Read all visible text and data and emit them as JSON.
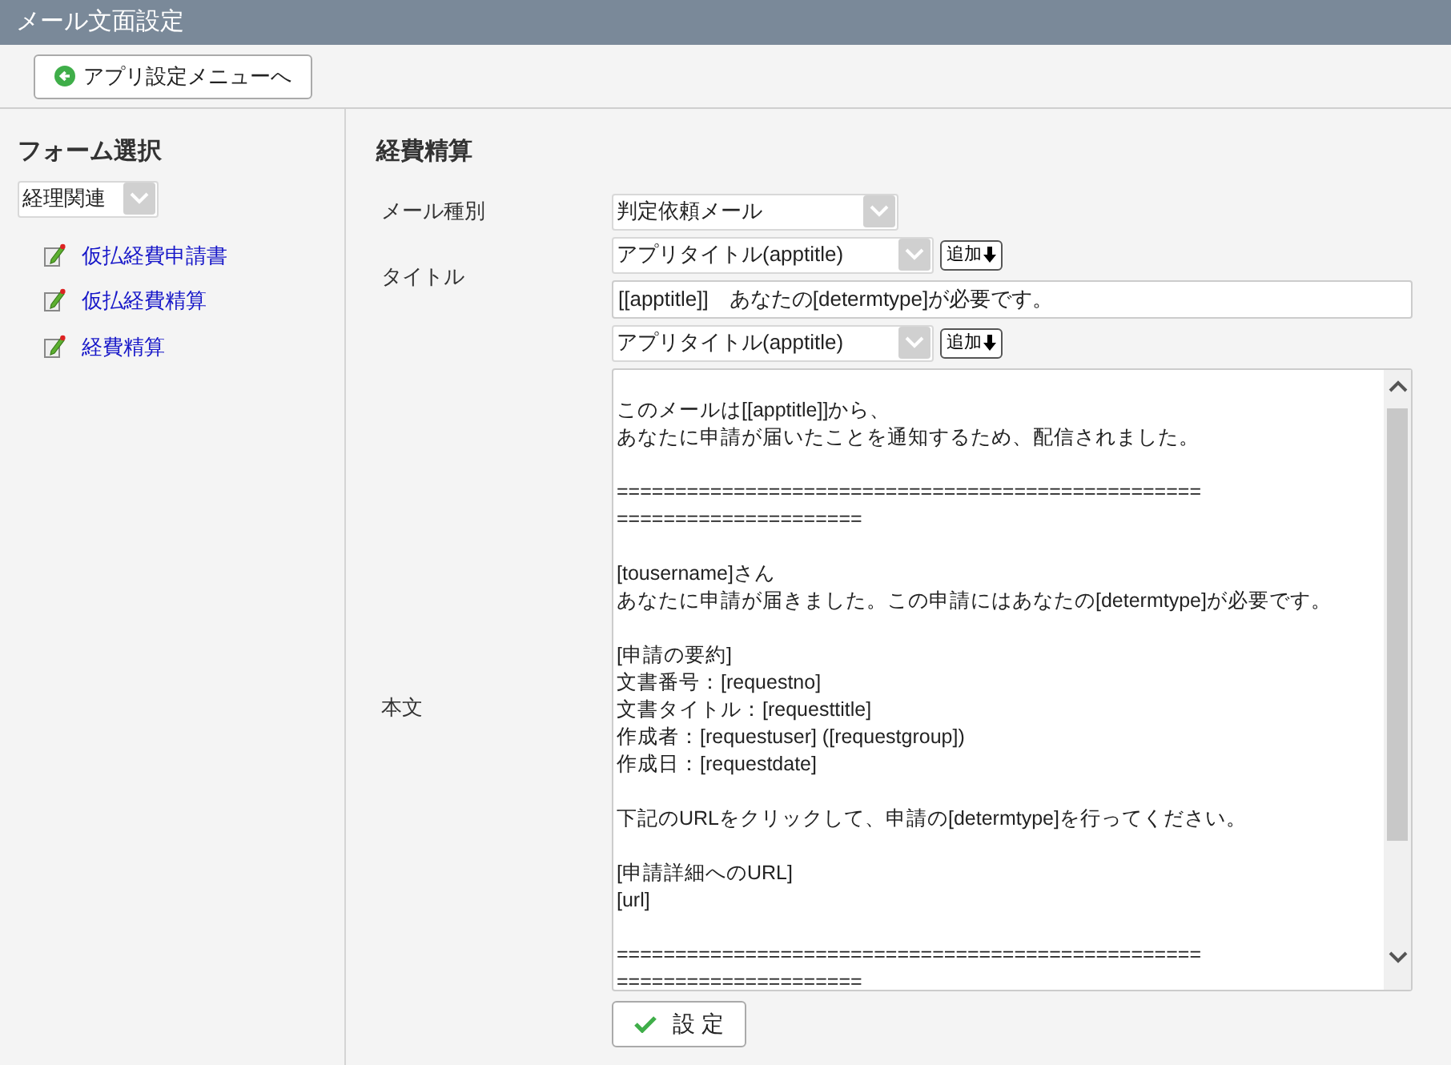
{
  "window": {
    "title": "メール文面設定"
  },
  "toolbar": {
    "back_button": "アプリ設定メニューへ"
  },
  "sidebar": {
    "heading": "フォーム選択",
    "category": "経理関連",
    "forms": [
      {
        "label": "仮払経費申請書"
      },
      {
        "label": "仮払経費精算"
      },
      {
        "label": "経費精算"
      }
    ]
  },
  "main": {
    "heading": "経費精算",
    "mail_type": {
      "label": "メール種別",
      "value": "判定依頼メール"
    },
    "title": {
      "label": "タイトル",
      "insert_select": "アプリタイトル(apptitle)",
      "add_button": "追加",
      "value": "[[apptitle]]　あなたの[determtype]が必要です。"
    },
    "body": {
      "label": "本文",
      "insert_select": "アプリタイトル(apptitle)",
      "add_button": "追加",
      "paragraphs": [
        [
          "このメールは[[apptitle]]から、",
          "あなたに申請が届いたことを通知するため、配信されました。"
        ],
        [
          "==================================================",
          "====================="
        ],
        [
          "[tousername]さん",
          "あなたに申請が届きました。この申請にはあなたの[determtype]が必要です。"
        ],
        [
          "[申請の要約]",
          "文書番号：[requestno]",
          "文書タイトル：[requesttitle]",
          "作成者：[requestuser] ([requestgroup])",
          "作成日：[requestdate]"
        ],
        [
          "下記のURLをクリックして、申請の[determtype]を行ってください。"
        ],
        [
          "[申請詳細へのURL]",
          "[url]"
        ],
        [
          "==================================================",
          "====================="
        ]
      ]
    },
    "submit_button": "設 定"
  }
}
